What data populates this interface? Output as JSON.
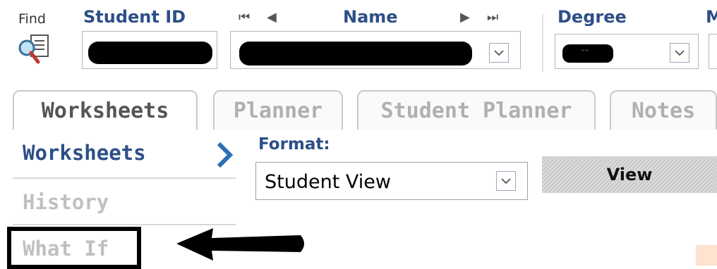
{
  "search": {
    "find_label": "Find",
    "student_id_label": "Student ID",
    "name_label": "Name",
    "degree_label": "Degree",
    "next_label_partial": "M",
    "degree_value": "--",
    "nav_first": "⏮",
    "nav_prev": "◀",
    "nav_next": "▶",
    "nav_last": "⏭"
  },
  "tabs": [
    {
      "label": "Worksheets",
      "active": true
    },
    {
      "label": "Planner",
      "active": false
    },
    {
      "label": "Student Planner",
      "active": false
    },
    {
      "label": "Notes",
      "active": false
    }
  ],
  "left_nav": [
    {
      "label": "Worksheets",
      "active": true
    },
    {
      "label": "History",
      "active": false
    },
    {
      "label": "What If",
      "active": false
    }
  ],
  "format": {
    "label": "Format:",
    "selected": "Student View",
    "button": "View"
  },
  "colors": {
    "accent": "#2c4f87",
    "inactive": "#c0c0c0",
    "redaction": "#000000"
  }
}
